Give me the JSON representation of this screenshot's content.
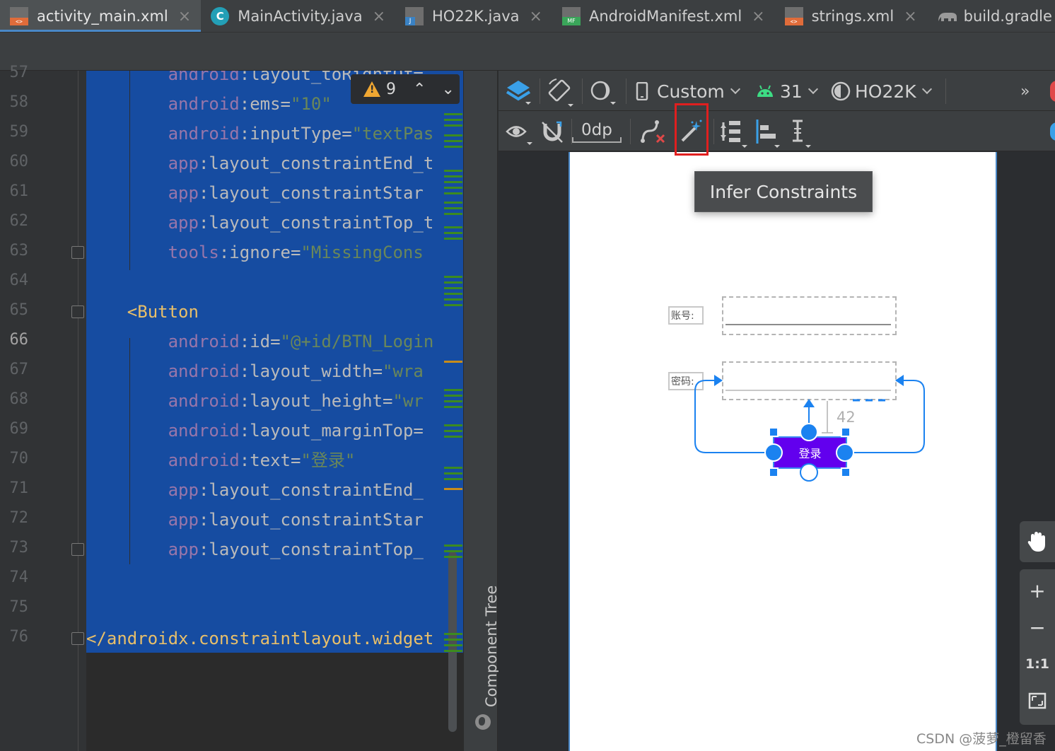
{
  "tabs": [
    {
      "label": "activity_main.xml",
      "icon": "xml-file-icon",
      "active": true
    },
    {
      "label": "MainActivity.java",
      "icon": "java-class-icon",
      "active": false
    },
    {
      "label": "HO22K.java",
      "icon": "java-file-icon",
      "active": false
    },
    {
      "label": "AndroidManifest.xml",
      "icon": "manifest-file-icon",
      "active": false
    },
    {
      "label": "strings.xml",
      "icon": "xml-file-icon",
      "active": false
    },
    {
      "label": "build.gradle (:a",
      "icon": "gradle-elephant-icon",
      "active": false
    }
  ],
  "editor": {
    "warning_count": "9",
    "lines": [
      {
        "n": "57",
        "indent": "        ",
        "ns": "android",
        "rest": ":layout_toRightOf=",
        "val": ""
      },
      {
        "n": "58",
        "indent": "        ",
        "ns": "android",
        "rest": ":ems=",
        "val": "\"10\""
      },
      {
        "n": "59",
        "indent": "        ",
        "ns": "android",
        "rest": ":inputType=",
        "val": "\"textPas"
      },
      {
        "n": "60",
        "indent": "        ",
        "ns": "app",
        "rest": ":layout_constraintEnd_t",
        "val": ""
      },
      {
        "n": "61",
        "indent": "        ",
        "ns": "app",
        "rest": ":layout_constraintStar",
        "val": ""
      },
      {
        "n": "62",
        "indent": "        ",
        "ns": "app",
        "rest": ":layout_constraintTop_t",
        "val": ""
      },
      {
        "n": "63",
        "indent": "        ",
        "ns": "tools",
        "rest": ":ignore=",
        "val": "\"MissingCons"
      },
      {
        "n": "64",
        "indent": "",
        "ns": "",
        "rest": "",
        "val": ""
      },
      {
        "n": "65",
        "indent": "    ",
        "tag": "<Button"
      },
      {
        "n": "66",
        "indent": "        ",
        "ns": "android",
        "rest": ":id=",
        "val": "\"@+id/BTN_Login"
      },
      {
        "n": "67",
        "indent": "        ",
        "ns": "android",
        "rest": ":layout_width=",
        "val": "\"wra"
      },
      {
        "n": "68",
        "indent": "        ",
        "ns": "android",
        "rest": ":layout_height=",
        "val": "\"wr"
      },
      {
        "n": "69",
        "indent": "        ",
        "ns": "android",
        "rest": ":layout_marginTop=",
        "val": ""
      },
      {
        "n": "70",
        "indent": "        ",
        "ns": "android",
        "rest": ":text=",
        "val": "\"登录\""
      },
      {
        "n": "71",
        "indent": "        ",
        "ns": "app",
        "rest": ":layout_constraintEnd_",
        "val": ""
      },
      {
        "n": "72",
        "indent": "        ",
        "ns": "app",
        "rest": ":layout_constraintStar",
        "val": ""
      },
      {
        "n": "73",
        "indent": "        ",
        "ns": "app",
        "rest": ":layout_constraintTop_",
        "val": ""
      },
      {
        "n": "74",
        "indent": "",
        "ns": "",
        "rest": "",
        "val": ""
      },
      {
        "n": "75",
        "indent": "",
        "ns": "",
        "rest": "",
        "val": ""
      },
      {
        "n": "76",
        "indent": "",
        "tag": "</androidx.constraintlayout.widget"
      }
    ],
    "current_line": "66"
  },
  "component_tree_label": "Component Tree",
  "design_toolbar": {
    "device": "Custom",
    "api_level": "31",
    "theme": "HO22K",
    "default_margin": "0dp",
    "overflow": "»"
  },
  "tooltip": "Infer Constraints",
  "layout_preview": {
    "account_label": "账号:",
    "password_label": "密码:",
    "login_button": "登录",
    "margin_value": "42"
  },
  "zoom_controls": {
    "zoom_in": "+",
    "zoom_out": "−",
    "actual_size": "1:1"
  },
  "watermark": "CSDN @菠萝_橙留香",
  "colors": {
    "selection": "#164ca1",
    "button": "#6200ee",
    "constraint": "#1b82f0",
    "highlight": "#e01f1f"
  }
}
